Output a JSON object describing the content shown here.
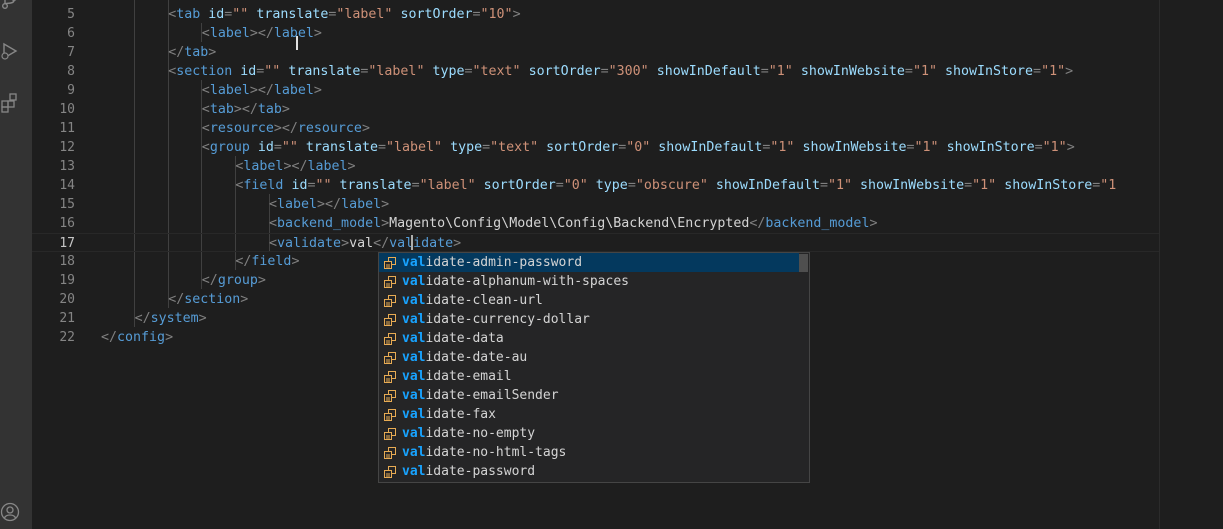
{
  "activity_bar": {
    "icons": [
      "source-control-icon",
      "run-debug-icon",
      "extensions-icon",
      "account-icon"
    ]
  },
  "editor": {
    "lines": [
      {
        "num": "5",
        "indent": 2,
        "tokens": [
          [
            "t",
            "<"
          ],
          [
            "tg",
            "tab"
          ],
          [
            "tx",
            " "
          ],
          [
            "at",
            "id"
          ],
          [
            "t",
            "="
          ],
          [
            "sv",
            "\"\""
          ],
          [
            "tx",
            " "
          ],
          [
            "at",
            "translate"
          ],
          [
            "t",
            "="
          ],
          [
            "sv",
            "\"label\""
          ],
          [
            "tx",
            " "
          ],
          [
            "at",
            "sortOrder"
          ],
          [
            "t",
            "="
          ],
          [
            "sv",
            "\"10\""
          ],
          [
            "t",
            ">"
          ]
        ]
      },
      {
        "num": "6",
        "indent": 3,
        "tokens": [
          [
            "t",
            "<"
          ],
          [
            "tg",
            "label"
          ],
          [
            "t",
            "></"
          ],
          [
            "tg",
            "label"
          ],
          [
            "t",
            ">"
          ]
        ]
      },
      {
        "num": "7",
        "indent": 2,
        "tokens": [
          [
            "t",
            "</"
          ],
          [
            "tg",
            "tab"
          ],
          [
            "t",
            ">"
          ]
        ]
      },
      {
        "num": "8",
        "indent": 2,
        "tokens": [
          [
            "t",
            "<"
          ],
          [
            "tg",
            "section"
          ],
          [
            "tx",
            " "
          ],
          [
            "at",
            "id"
          ],
          [
            "t",
            "="
          ],
          [
            "sv",
            "\"\""
          ],
          [
            "tx",
            " "
          ],
          [
            "at",
            "translate"
          ],
          [
            "t",
            "="
          ],
          [
            "sv",
            "\"label\""
          ],
          [
            "tx",
            " "
          ],
          [
            "at",
            "type"
          ],
          [
            "t",
            "="
          ],
          [
            "sv",
            "\"text\""
          ],
          [
            "tx",
            " "
          ],
          [
            "at",
            "sortOrder"
          ],
          [
            "t",
            "="
          ],
          [
            "sv",
            "\"300\""
          ],
          [
            "tx",
            " "
          ],
          [
            "at",
            "showInDefault"
          ],
          [
            "t",
            "="
          ],
          [
            "sv",
            "\"1\""
          ],
          [
            "tx",
            " "
          ],
          [
            "at",
            "showInWebsite"
          ],
          [
            "t",
            "="
          ],
          [
            "sv",
            "\"1\""
          ],
          [
            "tx",
            " "
          ],
          [
            "at",
            "showInStore"
          ],
          [
            "t",
            "="
          ],
          [
            "sv",
            "\"1\""
          ],
          [
            "t",
            ">"
          ]
        ]
      },
      {
        "num": "9",
        "indent": 3,
        "tokens": [
          [
            "t",
            "<"
          ],
          [
            "tg",
            "label"
          ],
          [
            "t",
            "></"
          ],
          [
            "tg",
            "label"
          ],
          [
            "t",
            ">"
          ]
        ]
      },
      {
        "num": "10",
        "indent": 3,
        "tokens": [
          [
            "t",
            "<"
          ],
          [
            "tg",
            "tab"
          ],
          [
            "t",
            "></"
          ],
          [
            "tg",
            "tab"
          ],
          [
            "t",
            ">"
          ]
        ]
      },
      {
        "num": "11",
        "indent": 3,
        "tokens": [
          [
            "t",
            "<"
          ],
          [
            "tg",
            "resource"
          ],
          [
            "t",
            "></"
          ],
          [
            "tg",
            "resource"
          ],
          [
            "t",
            ">"
          ]
        ]
      },
      {
        "num": "12",
        "indent": 3,
        "tokens": [
          [
            "t",
            "<"
          ],
          [
            "tg",
            "group"
          ],
          [
            "tx",
            " "
          ],
          [
            "at",
            "id"
          ],
          [
            "t",
            "="
          ],
          [
            "sv",
            "\"\""
          ],
          [
            "tx",
            " "
          ],
          [
            "at",
            "translate"
          ],
          [
            "t",
            "="
          ],
          [
            "sv",
            "\"label\""
          ],
          [
            "tx",
            " "
          ],
          [
            "at",
            "type"
          ],
          [
            "t",
            "="
          ],
          [
            "sv",
            "\"text\""
          ],
          [
            "tx",
            " "
          ],
          [
            "at",
            "sortOrder"
          ],
          [
            "t",
            "="
          ],
          [
            "sv",
            "\"0\""
          ],
          [
            "tx",
            " "
          ],
          [
            "at",
            "showInDefault"
          ],
          [
            "t",
            "="
          ],
          [
            "sv",
            "\"1\""
          ],
          [
            "tx",
            " "
          ],
          [
            "at",
            "showInWebsite"
          ],
          [
            "t",
            "="
          ],
          [
            "sv",
            "\"1\""
          ],
          [
            "tx",
            " "
          ],
          [
            "at",
            "showInStore"
          ],
          [
            "t",
            "="
          ],
          [
            "sv",
            "\"1\""
          ],
          [
            "t",
            ">"
          ]
        ]
      },
      {
        "num": "13",
        "indent": 4,
        "tokens": [
          [
            "t",
            "<"
          ],
          [
            "tg",
            "label"
          ],
          [
            "t",
            "></"
          ],
          [
            "tg",
            "label"
          ],
          [
            "t",
            ">"
          ]
        ]
      },
      {
        "num": "14",
        "indent": 4,
        "tokens": [
          [
            "t",
            "<"
          ],
          [
            "tg",
            "field"
          ],
          [
            "tx",
            " "
          ],
          [
            "at",
            "id"
          ],
          [
            "t",
            "="
          ],
          [
            "sv",
            "\"\""
          ],
          [
            "tx",
            " "
          ],
          [
            "at",
            "translate"
          ],
          [
            "t",
            "="
          ],
          [
            "sv",
            "\"label\""
          ],
          [
            "tx",
            " "
          ],
          [
            "at",
            "sortOrder"
          ],
          [
            "t",
            "="
          ],
          [
            "sv",
            "\"0\""
          ],
          [
            "tx",
            " "
          ],
          [
            "at",
            "type"
          ],
          [
            "t",
            "="
          ],
          [
            "sv",
            "\"obscure\""
          ],
          [
            "tx",
            " "
          ],
          [
            "at",
            "showInDefault"
          ],
          [
            "t",
            "="
          ],
          [
            "sv",
            "\"1\""
          ],
          [
            "tx",
            " "
          ],
          [
            "at",
            "showInWebsite"
          ],
          [
            "t",
            "="
          ],
          [
            "sv",
            "\"1\""
          ],
          [
            "tx",
            " "
          ],
          [
            "at",
            "showInStore"
          ],
          [
            "t",
            "="
          ],
          [
            "sv",
            "\"1"
          ]
        ]
      },
      {
        "num": "15",
        "indent": 5,
        "tokens": [
          [
            "t",
            "<"
          ],
          [
            "tg",
            "label"
          ],
          [
            "t",
            "></"
          ],
          [
            "tg",
            "label"
          ],
          [
            "t",
            ">"
          ]
        ]
      },
      {
        "num": "16",
        "indent": 5,
        "tokens": [
          [
            "t",
            "<"
          ],
          [
            "tg",
            "backend_model"
          ],
          [
            "t",
            ">"
          ],
          [
            "tx",
            "Magento\\Config\\Model\\Config\\Backend\\Encrypted"
          ],
          [
            "t",
            "</"
          ],
          [
            "tg",
            "backend_model"
          ],
          [
            "t",
            ">"
          ]
        ]
      },
      {
        "num": "17",
        "indent": 5,
        "current": true,
        "tokens": [
          [
            "t",
            "<"
          ],
          [
            "tg",
            "validate"
          ],
          [
            "t",
            ">"
          ],
          [
            "tx",
            "val"
          ],
          [
            "t",
            "</"
          ],
          [
            "tg",
            "validate"
          ],
          [
            "t",
            ">"
          ]
        ]
      },
      {
        "num": "18",
        "indent": 4,
        "tokens": [
          [
            "t",
            "</"
          ],
          [
            "tg",
            "field"
          ],
          [
            "t",
            ">"
          ]
        ]
      },
      {
        "num": "19",
        "indent": 3,
        "tokens": [
          [
            "t",
            "</"
          ],
          [
            "tg",
            "group"
          ],
          [
            "t",
            ">"
          ]
        ]
      },
      {
        "num": "20",
        "indent": 2,
        "tokens": [
          [
            "t",
            "</"
          ],
          [
            "tg",
            "section"
          ],
          [
            "t",
            ">"
          ]
        ]
      },
      {
        "num": "21",
        "indent": 1,
        "tokens": [
          [
            "t",
            "</"
          ],
          [
            "tg",
            "system"
          ],
          [
            "t",
            ">"
          ]
        ]
      },
      {
        "num": "22",
        "indent": 0,
        "tokens": [
          [
            "t",
            "</"
          ],
          [
            "tg",
            "config"
          ],
          [
            "t",
            ">"
          ]
        ]
      }
    ]
  },
  "suggest": {
    "match": "val",
    "icon": "snippet-icon",
    "items": [
      "idate-admin-password",
      "idate-alphanum-with-spaces",
      "idate-clean-url",
      "idate-currency-dollar",
      "idate-data",
      "idate-date-au",
      "idate-email",
      "idate-emailSender",
      "idate-fax",
      "idate-no-empty",
      "idate-no-html-tags",
      "idate-password"
    ],
    "selected_index": 0
  },
  "colors": {
    "background": "#1e1e1e",
    "tag": "#569cd6",
    "attribute": "#9cdcfe",
    "string": "#ce9178",
    "punctuation": "#808080",
    "match_highlight": "#18a3ff",
    "selection": "#04395e",
    "snippet_icon": "#e8ab53"
  }
}
